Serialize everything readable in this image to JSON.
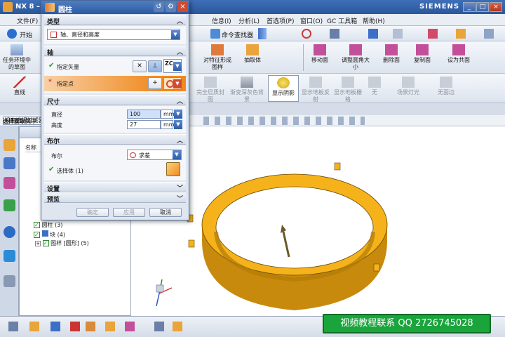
{
  "window": {
    "title": "NX 8 –",
    "brand": "SIEMENS"
  },
  "menubar": {
    "items": [
      "文件(F)",
      "信息(I)",
      "分析(L)",
      "首选项(P)",
      "窗口(O)",
      "GC 工具箱",
      "帮助(H)"
    ]
  },
  "toolbar1": {
    "start_label": "开始",
    "command_finder": "命令查找器"
  },
  "toolbar2": {
    "items": [
      "任务环境中的草图",
      "对特征形成图样",
      "抽取体",
      "移动面",
      "调整圆角大小",
      "删除面",
      "复制面",
      "设为共面"
    ]
  },
  "toolbar3": {
    "items": [
      "直线",
      "完全层质封图",
      "渐变深灰色背景",
      "显示阴影",
      "显示地板反射",
      "显示地板栅格",
      "无",
      "场景灯光",
      "无面边"
    ]
  },
  "filterrow": {
    "text": "没有选择过滤器"
  },
  "statusbar": {
    "text": "选择要取其中"
  },
  "navigator": {
    "column_header": "名称",
    "rows": [
      {
        "label": "圆柱 (3)"
      },
      {
        "label": "块 (4)"
      },
      {
        "label": "图样 [圆形] (5)"
      }
    ]
  },
  "dialog": {
    "title": "圆柱",
    "sections": {
      "type": {
        "title": "类型",
        "value": "轴、直径和高度"
      },
      "axis": {
        "title": "轴",
        "vector_label": "指定矢量",
        "point_label": "指定点",
        "vector_text": "ZC"
      },
      "size": {
        "title": "尺寸",
        "diameter_label": "直径",
        "diameter_value": "100",
        "height_label": "高度",
        "height_value": "27",
        "unit": "mm"
      },
      "boolean": {
        "title": "布尔",
        "boolean_label": "布尔",
        "boolean_value": "求差",
        "select_body_label": "选择体 (1)"
      },
      "settings": {
        "title": "设置"
      },
      "preview": {
        "title": "预览"
      }
    },
    "buttons": {
      "ok": "确定",
      "apply": "应用",
      "cancel": "取消"
    }
  },
  "watermark": {
    "text": "视频教程联系   QQ 2726745028"
  },
  "colors": {
    "part_fill": "#f5b21b",
    "part_dark": "#b87a08",
    "dialog_title": "#2c5ba3",
    "accent_orange": "#f08a20"
  }
}
